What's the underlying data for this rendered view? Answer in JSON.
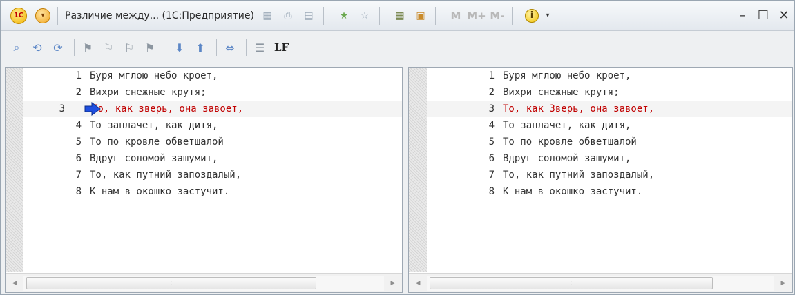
{
  "window": {
    "title": "Различие между... (1С:Предприятие)",
    "logo_text": "1С",
    "controls": [
      "minimize",
      "maximize",
      "close"
    ]
  },
  "title_icons": [
    "save-icon",
    "print-icon",
    "preview-icon",
    "favorites-icon",
    "bookmark-icon",
    "calculator-icon",
    "calendar-icon",
    "m-icon",
    "m-plus-icon",
    "m-minus-icon",
    "info-icon"
  ],
  "toolbar": {
    "lf_label": "LF",
    "buttons": [
      "find-icon",
      "find-prev-icon",
      "find-next-icon",
      "flag-icon",
      "flag-set-icon",
      "flag-next-icon",
      "flag-clear-icon",
      "arrow-down-icon",
      "arrow-up-icon",
      "sync-icon",
      "list-icon"
    ]
  },
  "left_pane": {
    "lines": [
      {
        "num": "1",
        "text": "Буря мглою небо кроет,"
      },
      {
        "num": "2",
        "text": "Вихри снежные крутя;"
      },
      {
        "num": "3",
        "text": "То, как зверь, она завоет,"
      },
      {
        "num": "4",
        "text": "То заплачет, как дитя,"
      },
      {
        "num": "5",
        "text": "То по кровле обветшалой"
      },
      {
        "num": "6",
        "text": "Вдруг соломой зашумит,"
      },
      {
        "num": "7",
        "text": "То, как путний запоздалый,"
      },
      {
        "num": "8",
        "text": "К нам в окошко застучит."
      }
    ]
  },
  "right_pane": {
    "lines": [
      {
        "num": "1",
        "text": "Буря мглою небо кроет,"
      },
      {
        "num": "2",
        "text": "Вихри снежные крутя;"
      },
      {
        "num": "3",
        "text": "То, как Зверь, она завоет,"
      },
      {
        "num": "4",
        "text": "То заплачет, как дитя,"
      },
      {
        "num": "5",
        "text": "То по кровле обветшалой"
      },
      {
        "num": "6",
        "text": "Вдруг соломой зашумит,"
      },
      {
        "num": "7",
        "text": "То, как путний запоздалый,"
      },
      {
        "num": "8",
        "text": "К нам в окошко застучит."
      }
    ]
  },
  "diff_line_index": 2,
  "colors": {
    "diff_text": "#c00000",
    "diff_row_bg": "#f4f4f4",
    "marker_arrow": "#1f4fe0"
  }
}
